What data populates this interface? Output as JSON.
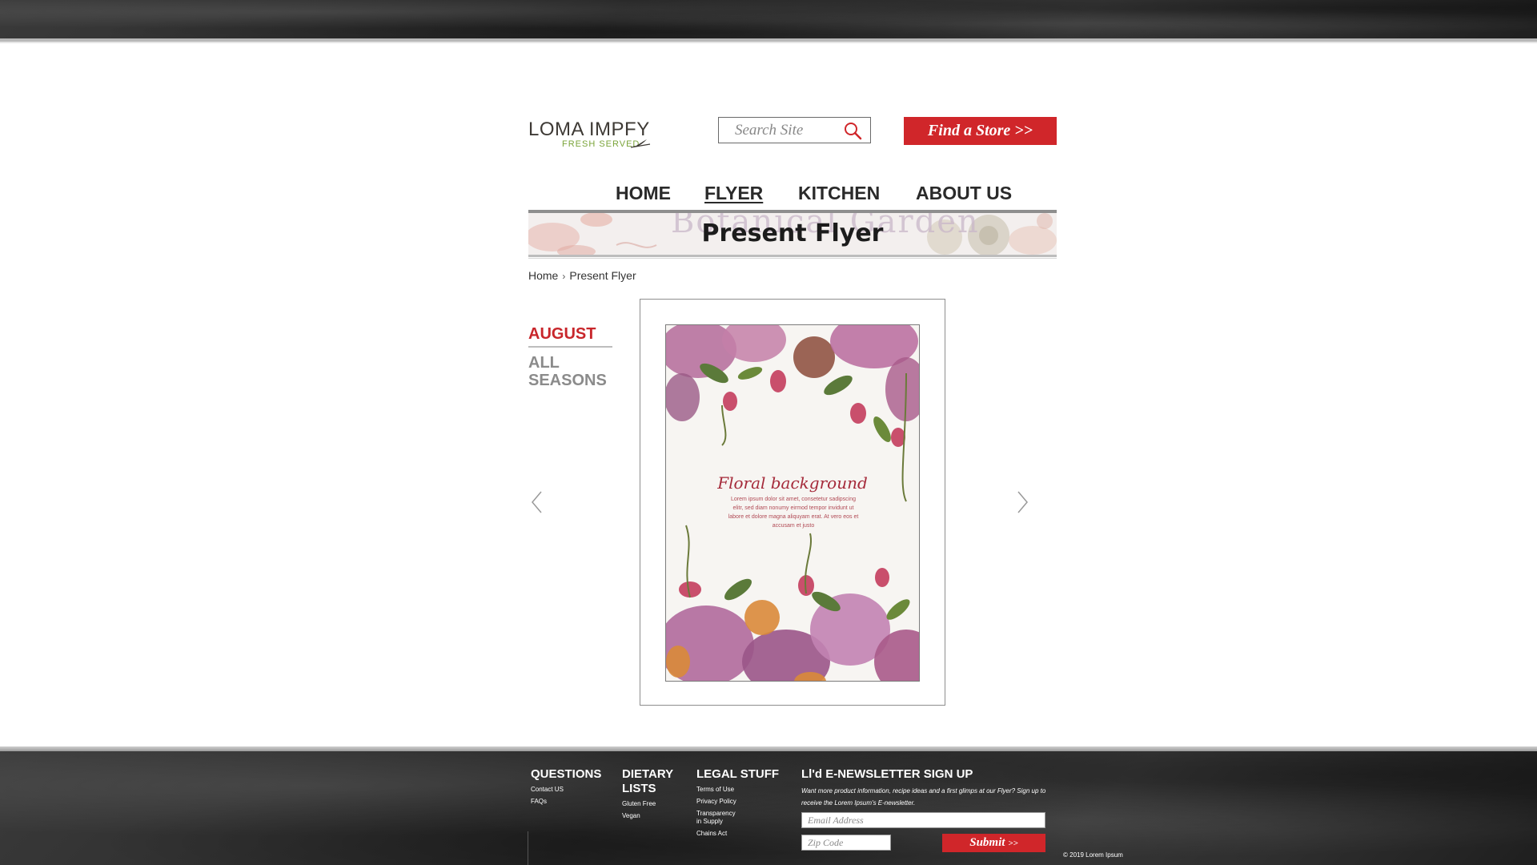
{
  "brand": {
    "name": "LOMA IMPFY",
    "tagline": "FRESH   SERVED",
    "colors": {
      "accent": "#d0262a",
      "green": "#7aa43a",
      "text": "#2a2a2a"
    }
  },
  "search": {
    "placeholder": "Search Site",
    "icon": "search-icon"
  },
  "store_button": {
    "label": "Find a Store >>"
  },
  "nav": {
    "items": [
      {
        "label": "HOME"
      },
      {
        "label": "FLYER",
        "active": true
      },
      {
        "label": "KITCHEN"
      },
      {
        "label": "ABOUT US"
      }
    ]
  },
  "banner": {
    "background_text": "Botanical Garden",
    "title": "Present Flyer"
  },
  "breadcrumb": {
    "home": "Home",
    "separator": "›",
    "current": "Present Flyer"
  },
  "seasons": {
    "current": "AUGUST",
    "all": "ALL SEASONS"
  },
  "flyer": {
    "title": "Floral background",
    "body": "Lorem ipsum dolor sit amet, consetetur sadipscing elitr, sed diam nonumy eirmod tempor invidunt ut labore et dolore magna aliquyam erat. At vero eos et accusam et justo",
    "prev_icon": "chevron-left-icon",
    "next_icon": "chevron-right-icon"
  },
  "footer": {
    "questions": {
      "heading": "QUESTIONS",
      "links": [
        "Contact US",
        "FAQs"
      ]
    },
    "dietary": {
      "heading": "DIETARY LISTS",
      "links": [
        "Gluten Free",
        "Vegan"
      ]
    },
    "legal": {
      "heading": "LEGAL STUFF",
      "links": [
        "Terms of Use",
        "Privacy Policy",
        "Transparency in Supply",
        "Chains Act"
      ]
    },
    "newsletter": {
      "heading": "Ll'd E-NEWSLETTER SIGN UP",
      "description": "Want more product information, recipe ideas and a first glimps at our Flyer? Sign up to receive the Lorem Ipsum's E-newsletter.",
      "email_placeholder": "Email Address",
      "zip_placeholder": "Zip Code",
      "submit_label": "Submit"
    },
    "copyright": "© 2019 Lorem Ipsum"
  }
}
